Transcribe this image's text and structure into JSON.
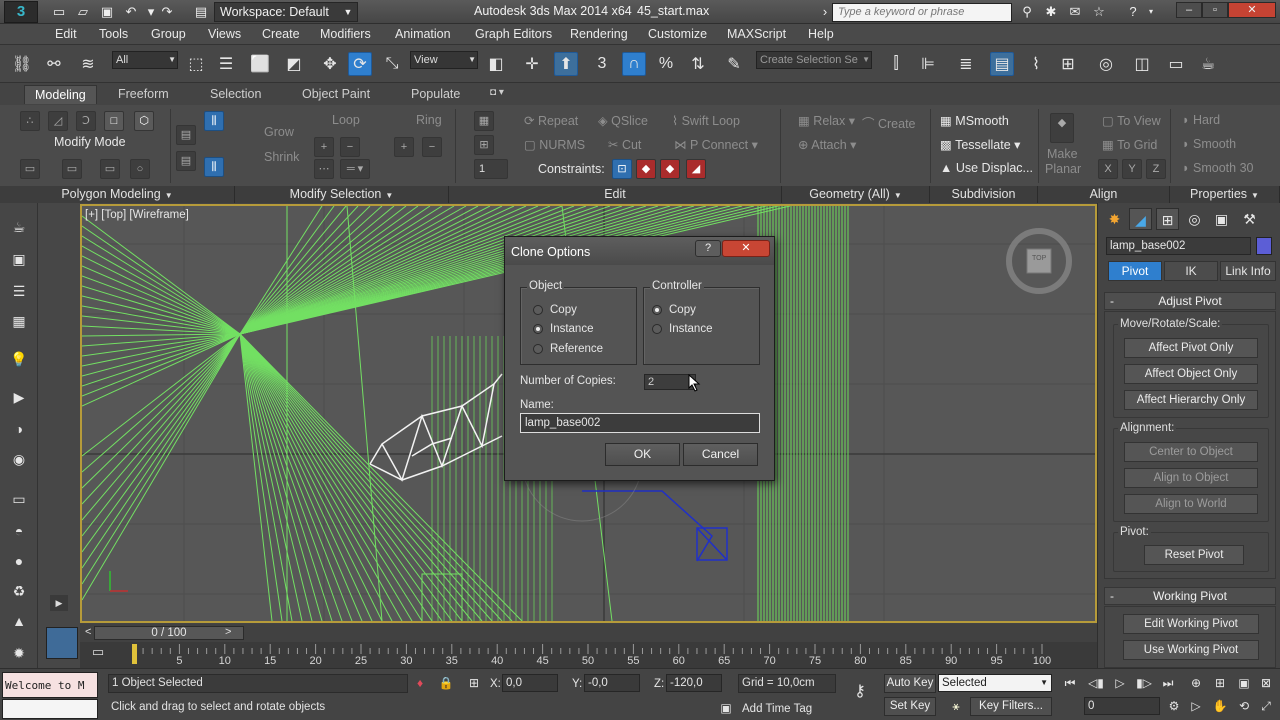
{
  "titlebar": {
    "logo_glyph": "3",
    "workspace": "Workspace: Default",
    "app_title": "Autodesk 3ds Max  2014 x64",
    "file_name": "45_start.max",
    "search_placeholder": "Type a keyword or phrase",
    "quick_access_icons": [
      "new-file-icon",
      "open-icon",
      "save-icon",
      "undo-icon",
      "redo-icon",
      "project-folder-icon"
    ]
  },
  "menu": [
    "Edit",
    "Tools",
    "Group",
    "Views",
    "Create",
    "Modifiers",
    "Animation",
    "Graph Editors",
    "Rendering",
    "Customize",
    "MAXScript",
    "Help"
  ],
  "toolbar": {
    "selection_filter": "All",
    "reference_coord": "View",
    "named_selection_placeholder": "Create Selection Se"
  },
  "ribbon": {
    "tabs": [
      "Modeling",
      "Freeform",
      "Selection",
      "Object Paint",
      "Populate"
    ],
    "modify_mode": "Modify Mode",
    "grow": "Grow",
    "shrink": "Shrink",
    "loop": "Loop",
    "ring": "Ring",
    "repeat": "Repeat",
    "qslice": "QSlice",
    "swift_loop": "Swift Loop",
    "nurms": "NURMS",
    "cut": "Cut",
    "p_connect": "P Connect",
    "constraints": "Constraints:",
    "constraint_value": "1",
    "relax": "Relax",
    "create": "Create",
    "attach": "Attach",
    "msmooth": "MSmooth",
    "tessellate": "Tessellate",
    "use_displace": "Use Displac...",
    "make_planar_1": "Make",
    "make_planar_2": "Planar",
    "to_view": "To View",
    "to_grid": "To Grid",
    "axis_x": "X",
    "axis_y": "Y",
    "axis_z": "Z",
    "hard": "Hard",
    "smooth": "Smooth",
    "smooth30": "Smooth 30",
    "footers": [
      "Polygon Modeling",
      "Modify Selection",
      "Edit",
      "Geometry (All)",
      "Subdivision",
      "Align",
      "Properties"
    ]
  },
  "viewport": {
    "label": "[+] [Top] [Wireframe]",
    "viewcube_label": "TOP"
  },
  "dialog": {
    "title": "Clone Options",
    "help": "?",
    "close": "✕",
    "object_group": "Object",
    "object_options": [
      "Copy",
      "Instance",
      "Reference"
    ],
    "object_selected": "Instance",
    "controller_group": "Controller",
    "controller_options": [
      "Copy",
      "Instance"
    ],
    "controller_selected": "Copy",
    "copies_label": "Number of Copies:",
    "copies_value": "2",
    "name_label": "Name:",
    "name_value": "lamp_base002",
    "ok": "OK",
    "cancel": "Cancel"
  },
  "command_panel": {
    "object_name": "lamp_base002",
    "object_color": "#5c5ed6",
    "subtabs": [
      "Pivot",
      "IK",
      "Link Info"
    ],
    "adjust_pivot": "Adjust Pivot",
    "move_rotate_scale": "Move/Rotate/Scale:",
    "affect_pivot": "Affect Pivot Only",
    "affect_object": "Affect Object Only",
    "affect_hierarchy": "Affect Hierarchy Only",
    "alignment": "Alignment:",
    "center_to_object": "Center to Object",
    "align_to_object": "Align to Object",
    "align_to_world": "Align to World",
    "pivot": "Pivot:",
    "reset_pivot": "Reset Pivot",
    "working_pivot": "Working Pivot",
    "edit_working_pivot": "Edit Working Pivot",
    "use_working_pivot": "Use Working Pivot",
    "minus": "-"
  },
  "timeline": {
    "frame_display": "0 / 100",
    "ticks": [
      "0",
      "5",
      "10",
      "15",
      "20",
      "25",
      "30",
      "35",
      "40",
      "45",
      "50",
      "55",
      "60",
      "65",
      "70",
      "75",
      "80",
      "85",
      "90",
      "95",
      "100"
    ]
  },
  "status": {
    "maxscript": "Welcome to M",
    "selected": "1 Object Selected",
    "prompt": "Click and drag to select and rotate objects",
    "x_label": "X:",
    "x": "0,0",
    "y_label": "Y:",
    "y": "-0,0",
    "z_label": "Z:",
    "z": "-120,0",
    "grid": "Grid = 10,0cm",
    "add_time_tag": "Add Time Tag",
    "auto_key": "Auto Key",
    "set_key": "Set Key",
    "selected_dd": "Selected",
    "key_filters": "Key Filters...",
    "frame": "0"
  }
}
